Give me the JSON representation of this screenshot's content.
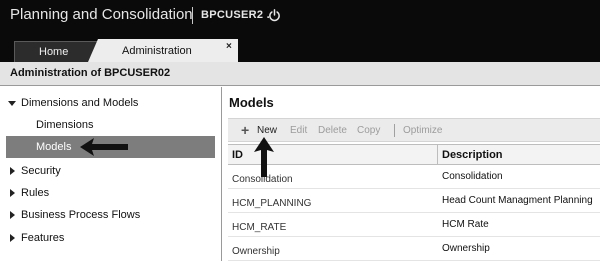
{
  "header": {
    "app_title": "Planning and Consolidation",
    "user": "BPCUSER2 ."
  },
  "tabs": [
    {
      "label": "Home"
    },
    {
      "label": "Administration",
      "close": "×"
    }
  ],
  "page": {
    "title": "Administration of BPCUSER02"
  },
  "nav": {
    "items": [
      {
        "label": "Dimensions and Models",
        "expanded": true
      },
      {
        "label": "Dimensions"
      },
      {
        "label": "Models",
        "selected": true
      },
      {
        "label": "Security"
      },
      {
        "label": "Rules"
      },
      {
        "label": "Business Process Flows"
      },
      {
        "label": "Features"
      }
    ]
  },
  "main": {
    "section_title": "Models",
    "toolbar": {
      "new": "New",
      "edit": "Edit",
      "delete": "Delete",
      "copy": "Copy",
      "optimize": "Optimize"
    },
    "table": {
      "columns": [
        "ID",
        "Description"
      ],
      "rows": [
        {
          "id": "Consolidation",
          "description": "Consolidation"
        },
        {
          "id": "HCM_PLANNING",
          "description": "Head Count Managment Planning"
        },
        {
          "id": "HCM_RATE",
          "description": "HCM Rate"
        },
        {
          "id": "Ownership",
          "description": "Ownership"
        }
      ]
    }
  },
  "icons": {
    "power": "power-icon",
    "plus": "plus-icon",
    "close": "close-icon",
    "expand": "chevron-down-icon",
    "collapse": "chevron-right-icon"
  },
  "colors": {
    "header_bg": "#0a0a0a",
    "selected_nav_bg": "#7d7d7d",
    "toolbar_bg": "#ebebeb",
    "disabled_text": "#9c9c9c"
  }
}
